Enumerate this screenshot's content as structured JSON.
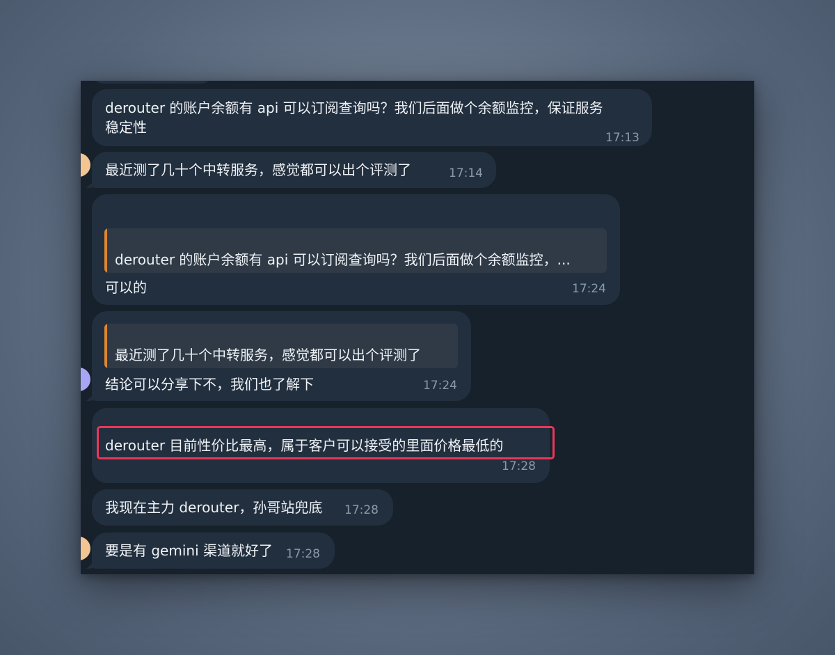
{
  "messages": [
    {
      "text": "derouter 的账户余额有 api 可以订阅查询吗？我们后面做个余额监控，保证服务",
      "text_line2": "稳定性",
      "time": "17:13"
    },
    {
      "text": "最近测了几十个中转服务，感觉都可以出个评测了",
      "time": "17:14"
    },
    {
      "quote": "derouter 的账户余额有 api 可以订阅查询吗？我们后面做个余额监控，...",
      "text": "可以的",
      "time": "17:24"
    },
    {
      "quote": "最近测了几十个中转服务，感觉都可以出个评测了",
      "text": "结论可以分享下不，我们也了解下",
      "time": "17:24"
    },
    {
      "text": "derouter 目前性价比最高，属于客户可以接受的里面价格最低的",
      "time": "17:28"
    },
    {
      "text": "我现在主力 derouter，孙哥站兜底",
      "time": "17:28"
    },
    {
      "text": "要是有 gemini 渠道就好了",
      "time": "17:28"
    }
  ],
  "colors": {
    "bubble": "#222f3e",
    "window_bg": "#17212b",
    "quote_accent": "#e0862d",
    "highlight": "#e8375a"
  }
}
